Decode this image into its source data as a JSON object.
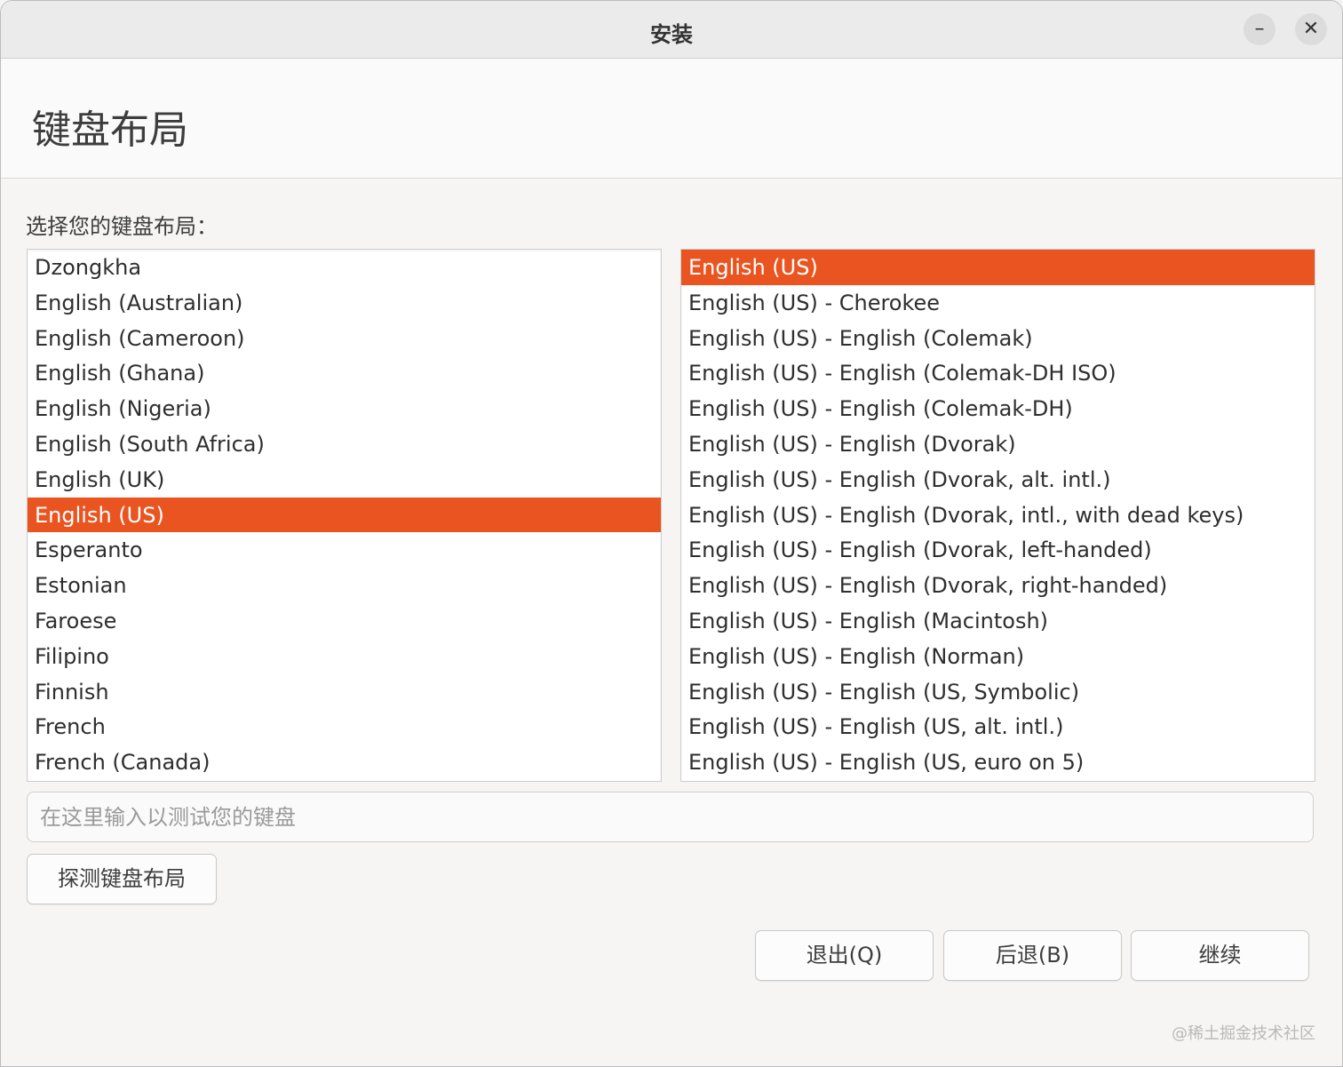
{
  "window": {
    "title": "安装",
    "minimize_glyph": "–",
    "close_glyph": "✕"
  },
  "header": {
    "title": "键盘布局"
  },
  "prompt": "选择您的键盘布局：",
  "layouts": {
    "items": [
      "Dzongkha",
      "English (Australian)",
      "English (Cameroon)",
      "English (Ghana)",
      "English (Nigeria)",
      "English (South Africa)",
      "English (UK)",
      "English (US)",
      "Esperanto",
      "Estonian",
      "Faroese",
      "Filipino",
      "Finnish",
      "French",
      "French (Canada)"
    ],
    "selected": "English (US)"
  },
  "variants": {
    "items": [
      "English (US)",
      "English (US) - Cherokee",
      "English (US) - English (Colemak)",
      "English (US) - English (Colemak-DH ISO)",
      "English (US) - English (Colemak-DH)",
      "English (US) - English (Dvorak)",
      "English (US) - English (Dvorak, alt. intl.)",
      "English (US) - English (Dvorak, intl., with dead keys)",
      "English (US) - English (Dvorak, left-handed)",
      "English (US) - English (Dvorak, right-handed)",
      "English (US) - English (Macintosh)",
      "English (US) - English (Norman)",
      "English (US) - English (US, Symbolic)",
      "English (US) - English (US, alt. intl.)",
      "English (US) - English (US, euro on 5)"
    ],
    "selected": "English (US)"
  },
  "test_field": {
    "placeholder": "在这里输入以测试您的键盘",
    "value": ""
  },
  "buttons": {
    "detect": "探测键盘布局",
    "quit": "退出(Q)",
    "back": "后退(B)",
    "continue": "继续"
  },
  "watermark": "@稀土掘金技术社区",
  "colors": {
    "accent": "#e95420"
  }
}
